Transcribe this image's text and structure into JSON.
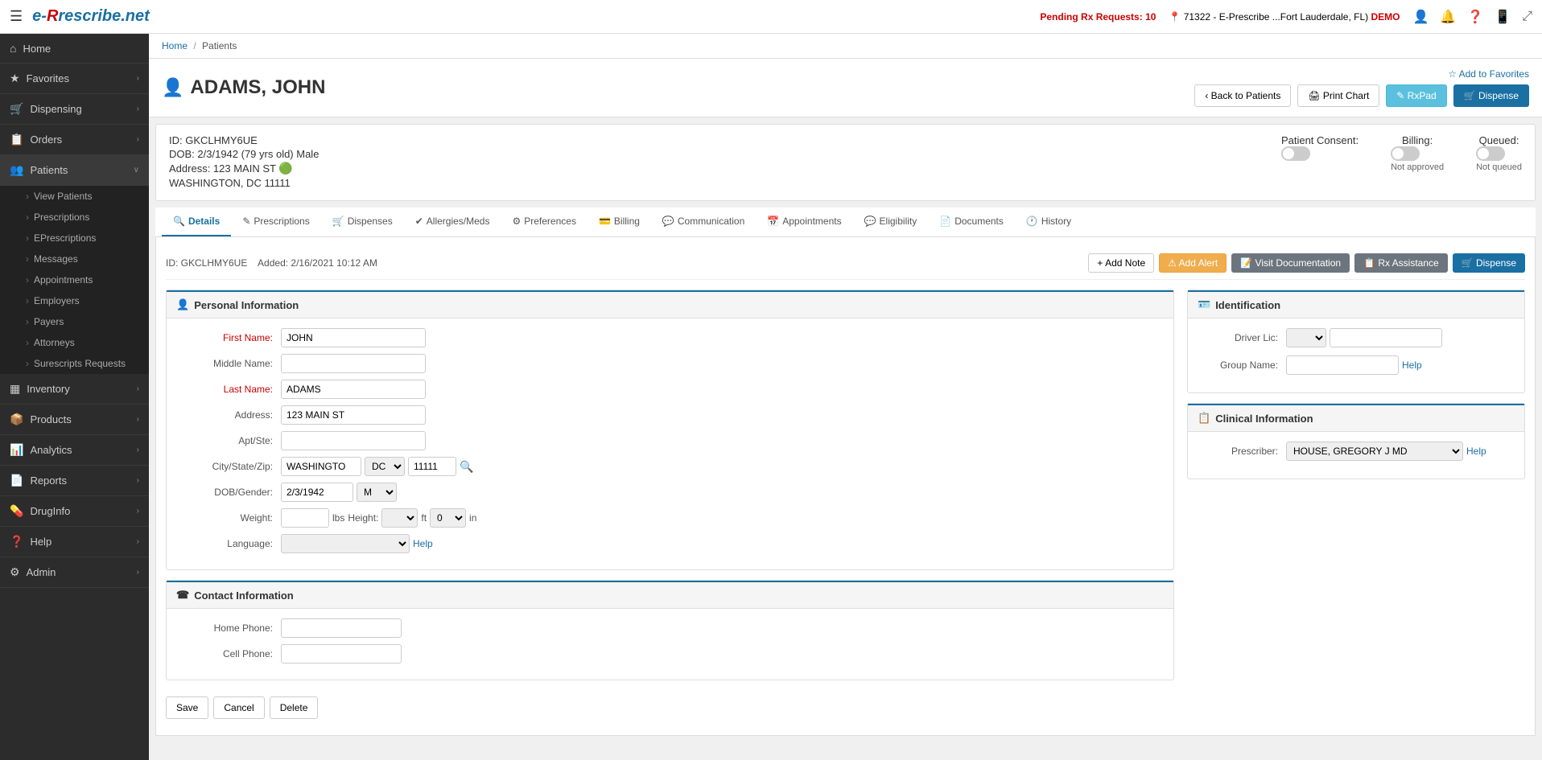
{
  "app": {
    "logo": "e-Rrescribe.net",
    "hamburger": "☰"
  },
  "header": {
    "pending_rx_label": "Pending Rx Requests:",
    "pending_rx_count": "10",
    "location": "71322 - E-Prescribe ...Fort Lauderdale, FL)",
    "demo": "DEMO",
    "icons": {
      "user": "👤",
      "bell": "🔔",
      "question": "❓",
      "mobile": "📱",
      "expand": "⤢"
    }
  },
  "sidebar": {
    "items": [
      {
        "id": "home",
        "label": "Home",
        "icon": "⌂",
        "has_children": false
      },
      {
        "id": "favorites",
        "label": "Favorites",
        "icon": "★",
        "has_children": true
      },
      {
        "id": "dispensing",
        "label": "Dispensing",
        "icon": "🛒",
        "has_children": true
      },
      {
        "id": "orders",
        "label": "Orders",
        "icon": "📋",
        "has_children": true
      },
      {
        "id": "patients",
        "label": "Patients",
        "icon": "👥",
        "has_children": true,
        "active": true
      },
      {
        "id": "inventory",
        "label": "Inventory",
        "icon": "▦",
        "has_children": true
      },
      {
        "id": "products",
        "label": "Products",
        "icon": "📦",
        "has_children": true
      },
      {
        "id": "analytics",
        "label": "Analytics",
        "icon": "📊",
        "has_children": true
      },
      {
        "id": "reports",
        "label": "Reports",
        "icon": "📄",
        "has_children": true
      },
      {
        "id": "druginfo",
        "label": "DrugInfo",
        "icon": "💊",
        "has_children": true
      },
      {
        "id": "help",
        "label": "Help",
        "icon": "❓",
        "has_children": true
      },
      {
        "id": "admin",
        "label": "Admin",
        "icon": "⚙",
        "has_children": true
      }
    ],
    "patients_subitems": [
      "View Patients",
      "Prescriptions",
      "EPrescriptions",
      "Messages",
      "Appointments",
      "Employers",
      "Payers",
      "Attorneys",
      "Surescripts Requests"
    ]
  },
  "breadcrumb": {
    "home": "Home",
    "separator": "/",
    "current": "Patients"
  },
  "patient": {
    "icon": "👤",
    "name": "ADAMS, JOHN",
    "add_favorites": "☆ Add to Favorites",
    "back_button": "‹ Back to Patients",
    "print_button": "🖨 Print Chart",
    "rxpad_button": "✎ RxPad",
    "dispense_button": "🛒 Dispense",
    "id": "GKCLHMY6UE",
    "dob": "2/3/1942 (79 yrs old) Male",
    "address": "123 MAIN ST",
    "city_state_zip": "WASHINGTON, DC 11111",
    "consent_label": "Patient Consent:",
    "consent_status": "",
    "billing_label": "Billing:",
    "billing_status": "Not approved",
    "queued_label": "Queued:",
    "queued_status": "Not queued"
  },
  "tabs": [
    {
      "id": "details",
      "label": "Details",
      "icon": "🔍",
      "active": true
    },
    {
      "id": "prescriptions",
      "label": "Prescriptions",
      "icon": "✎"
    },
    {
      "id": "dispenses",
      "label": "Dispenses",
      "icon": "🛒"
    },
    {
      "id": "allergies",
      "label": "Allergies/Meds",
      "icon": "✔"
    },
    {
      "id": "preferences",
      "label": "Preferences",
      "icon": "⚙"
    },
    {
      "id": "billing",
      "label": "Billing",
      "icon": "💳"
    },
    {
      "id": "communication",
      "label": "Communication",
      "icon": "💬"
    },
    {
      "id": "appointments",
      "label": "Appointments",
      "icon": "📅"
    },
    {
      "id": "eligibility",
      "label": "Eligibility",
      "icon": "💬"
    },
    {
      "id": "documents",
      "label": "Documents",
      "icon": "📄"
    },
    {
      "id": "history",
      "label": "History",
      "icon": "🕐"
    }
  ],
  "action_bar": {
    "id_label": "ID: GKCLHMY6UE",
    "added_label": "Added: 2/16/2021 10:12 AM",
    "add_note": "+ Add Note",
    "add_alert": "⚠ Add Alert",
    "visit_doc": "📝 Visit Documentation",
    "rx_assist": "📋 Rx Assistance",
    "dispense": "🛒 Dispense"
  },
  "personal_info": {
    "title": "Personal Information",
    "icon": "👤",
    "fields": {
      "first_name_label": "First Name:",
      "first_name_value": "JOHN",
      "middle_name_label": "Middle Name:",
      "middle_name_value": "",
      "last_name_label": "Last Name:",
      "last_name_value": "ADAMS",
      "address_label": "Address:",
      "address_value": "123 MAIN ST",
      "apt_label": "Apt/Ste:",
      "apt_value": "",
      "city_label": "City/State/Zip:",
      "city_value": "WASHINGTO",
      "state_value": "DC",
      "zip_value": "11111",
      "dob_label": "DOB/Gender:",
      "dob_value": "2/3/1942",
      "gender_value": "M",
      "weight_label": "Weight:",
      "weight_value": "",
      "weight_unit": "lbs",
      "height_label": "Height:",
      "height_ft": "",
      "height_ft_unit": "ft",
      "height_in_value": "0",
      "height_in_unit": "in",
      "language_label": "Language:",
      "language_value": "",
      "help_link": "Help"
    }
  },
  "contact_info": {
    "title": "Contact Information",
    "icon": "☎",
    "fields": {
      "home_phone_label": "Home Phone:",
      "home_phone_value": "",
      "cell_phone_label": "Cell Phone:",
      "cell_phone_value": ""
    }
  },
  "identification": {
    "title": "Identification",
    "icon": "🪪",
    "fields": {
      "driver_lic_label": "Driver Lic:",
      "driver_lic_type": "",
      "driver_lic_value": "",
      "group_name_label": "Group Name:",
      "group_name_value": "",
      "help_link": "Help"
    }
  },
  "clinical_info": {
    "title": "Clinical Information",
    "icon": "📋",
    "fields": {
      "prescriber_label": "Prescriber:",
      "prescriber_value": "HOUSE, GREGORY J MD",
      "help_link": "Help"
    }
  },
  "buttons": {
    "save": "Save",
    "cancel": "Cancel",
    "delete": "Delete"
  },
  "assistance": {
    "label": "Assistance"
  }
}
